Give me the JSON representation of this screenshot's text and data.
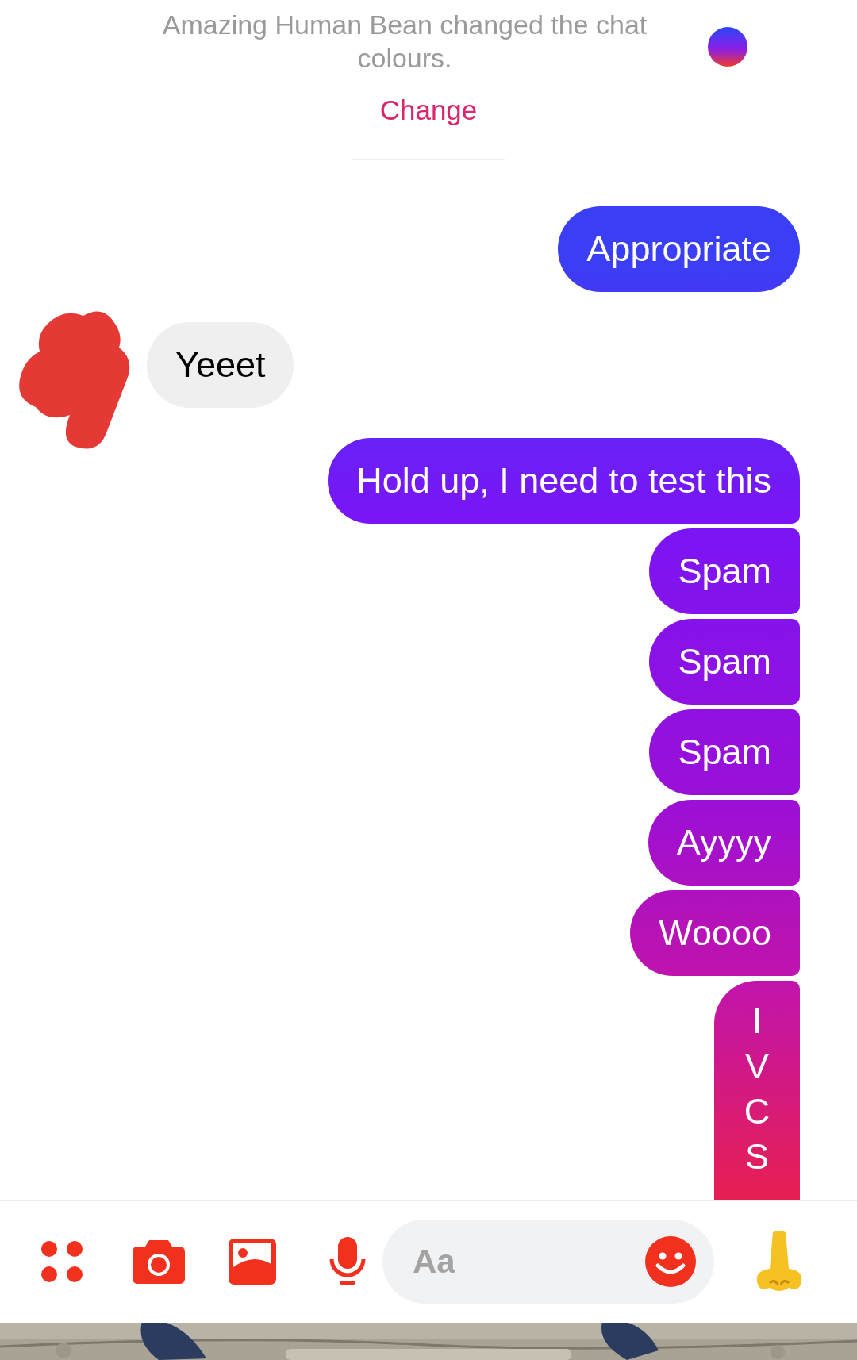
{
  "notice": {
    "text": "Amazing Human Bean changed the chat colours.",
    "action": "Change"
  },
  "messages": [
    {
      "outgoing": true,
      "text": "Appropriate"
    },
    {
      "outgoing": false,
      "text": "Yeeet",
      "avatar": true
    },
    {
      "outgoing": true,
      "text": "Hold up, I need to test this"
    },
    {
      "outgoing": true,
      "text": "Spam"
    },
    {
      "outgoing": true,
      "text": "Spam"
    },
    {
      "outgoing": true,
      "text": "Spam"
    },
    {
      "outgoing": true,
      "text": "Ayyyy"
    },
    {
      "outgoing": true,
      "text": "Woooo"
    },
    {
      "outgoing": true,
      "kind": "vertical",
      "lines": [
        "I",
        "V",
        "C",
        "S"
      ]
    }
  ],
  "composer": {
    "placeholder": "Aa"
  }
}
